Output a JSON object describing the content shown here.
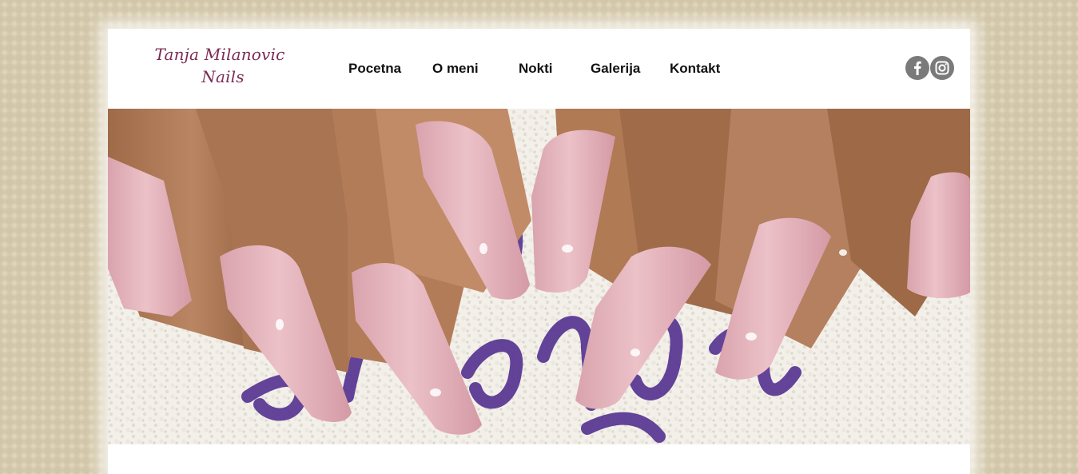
{
  "brand": {
    "line1": "Tanja Milanovic",
    "line2": "Nails",
    "color": "#7c2b55"
  },
  "nav": {
    "items": [
      {
        "label": "Pocetna"
      },
      {
        "label": "O meni"
      },
      {
        "label": "Nokti"
      },
      {
        "label": "Galerija"
      },
      {
        "label": "Kontakt"
      }
    ]
  },
  "social": {
    "facebook_icon": "facebook-icon",
    "instagram_icon": "instagram-icon",
    "icon_color": "#7a7a7a"
  },
  "hero": {
    "image": "photo of manicured hands with long pink coffin nails on a white towel with purple embroidery",
    "nail_color": "#e7b8c0",
    "skin_color": "#b07a55",
    "embroidery_color": "#5b3a94"
  },
  "colors": {
    "page_bg": "#d8ccae",
    "content_bg": "#ffffff",
    "nav_text": "#111111"
  }
}
